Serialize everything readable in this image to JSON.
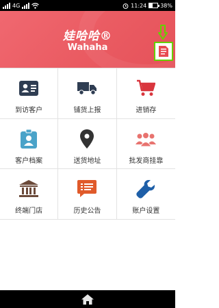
{
  "statusbar": {
    "network": "4G",
    "time": "11:24",
    "battery_text": "38%",
    "battery_level": 0.38
  },
  "header": {
    "brand_cn": "娃哈哈®",
    "brand_en": "Wahaha",
    "accent_color": "#e85a61",
    "highlight_color": "#66d000"
  },
  "menu": [
    {
      "label": "到访客户",
      "icon": "contact-card-icon",
      "color": "#2f3d52"
    },
    {
      "label": "铺货上报",
      "icon": "delivery-truck-icon",
      "color": "#2f3d52"
    },
    {
      "label": "进销存",
      "icon": "shopping-cart-icon",
      "color": "#d9363e"
    },
    {
      "label": "客户档案",
      "icon": "customer-badge-icon",
      "color": "#4aa3c9"
    },
    {
      "label": "送货地址",
      "icon": "map-pin-icon",
      "color": "#333333"
    },
    {
      "label": "批发商挂靠",
      "icon": "people-group-icon",
      "color": "#e8736f"
    },
    {
      "label": "终端门店",
      "icon": "store-building-icon",
      "color": "#6b4a3a"
    },
    {
      "label": "历史公告",
      "icon": "announcement-icon",
      "color": "#e05a2a"
    },
    {
      "label": "账户设置",
      "icon": "wrench-icon",
      "color": "#1e5fa8"
    }
  ]
}
